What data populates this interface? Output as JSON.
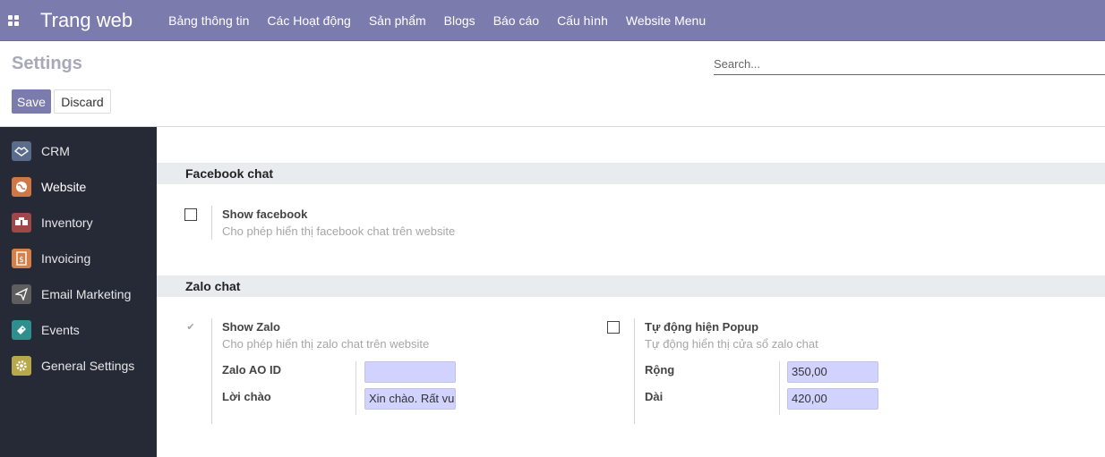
{
  "navbar": {
    "app_icon": "apps-grid-icon",
    "brand": "Trang web",
    "menu": [
      "Bảng thông tin",
      "Các Hoạt động",
      "Sản phẩm",
      "Blogs",
      "Báo cáo",
      "Cấu hình",
      "Website Menu"
    ],
    "color": "#7c7bad"
  },
  "control_panel": {
    "title": "Settings",
    "search_placeholder": "Search...",
    "save_label": "Save",
    "discard_label": "Discard"
  },
  "sidebar": {
    "items": [
      {
        "label": "CRM",
        "icon": "handshake-icon",
        "color": "#5a6b8c"
      },
      {
        "label": "Website",
        "icon": "globe-icon",
        "color": "#d07845",
        "active": true
      },
      {
        "label": "Inventory",
        "icon": "boxes-icon",
        "color": "#a04848"
      },
      {
        "label": "Invoicing",
        "icon": "invoice-icon",
        "color": "#d4804a"
      },
      {
        "label": "Email Marketing",
        "icon": "paper-plane-icon",
        "color": "#5e5e5e"
      },
      {
        "label": "Events",
        "icon": "ticket-icon",
        "color": "#2f8f8f"
      },
      {
        "label": "General Settings",
        "icon": "gear-icon",
        "color": "#b7a94b"
      }
    ]
  },
  "facebook": {
    "header": "Facebook chat",
    "title": "Show facebook",
    "description": "Cho phép hiển thị facebook chat trên website"
  },
  "zalo": {
    "header": "Zalo chat",
    "show_title": "Show Zalo",
    "show_description": "Cho phép hiển thị zalo chat trên website",
    "oa_label": "Zalo AO ID",
    "oa_value": "",
    "greeting_label": "Lời chào",
    "greeting_value": "Xin chào. Rất vui",
    "popup_title": "Tự động hiện Popup",
    "popup_description": "Tự động hiển thị cửa sổ zalo chat",
    "width_label": "Rộng",
    "width_value": "350,00",
    "height_label": "Dài",
    "height_value": "420,00"
  }
}
